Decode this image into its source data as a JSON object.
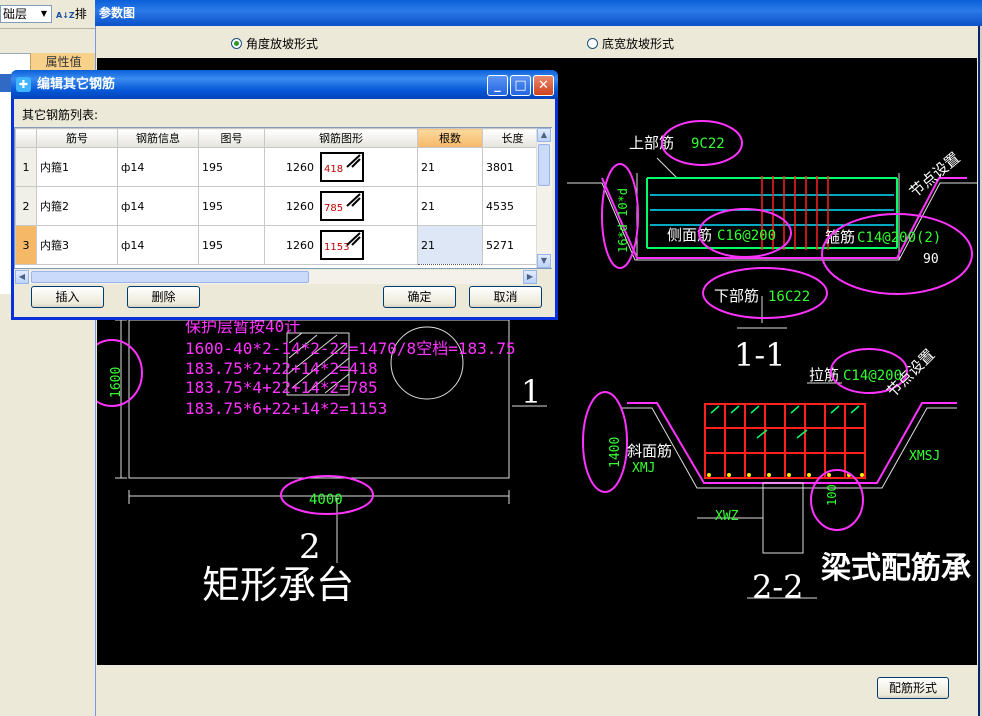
{
  "background_app": {
    "layer_select": "础层",
    "sort_label": "排",
    "attr_header": "属性值"
  },
  "param_window": {
    "title": "参数图",
    "radio_angle": "角度放坡形式",
    "radio_base": "底宽放坡形式",
    "radio_selected": "angle",
    "rebar_form_button": "配筋形式"
  },
  "drawing": {
    "top_bar_label": "上部筋",
    "top_bar_value": "9C22",
    "side_bar_label": "侧面筋",
    "side_bar_value": "C16@200",
    "stirrup_label": "箍筋",
    "stirrup_value": "C14@200(2)",
    "bottom_bar_label": "下部筋",
    "bottom_bar_value": "16C22",
    "anchor_label": "16*d 10*d",
    "angle_value": "90",
    "node_setting_1": "节点设置",
    "section_1": "1-1",
    "tie_label": "拉筋",
    "tie_value": "C14@200",
    "node_setting_2": "节点设置",
    "slope_bar_label": "斜面筋",
    "xmj": "XMJ",
    "xmsj": "XMSJ",
    "xwz": "XWZ",
    "height_1400": "1400",
    "dim_100": "100",
    "section_2": "2-2",
    "beam_title": "梁式配筋承",
    "calc_lines": [
      "保护层暂按40计",
      "1600-40*2-14*2-22=1470/8空档=183.75",
      "183.75*2+22+14*2=418",
      "183.75*4+22+14*2=785",
      "183.75*6+22+14*2=1153"
    ],
    "height_1600": "1600",
    "width_4000": "4000",
    "view_1": "1",
    "view_2": "2",
    "rect_title": "矩形承台"
  },
  "dialog": {
    "title": "编辑其它钢筋",
    "list_label": "其它钢筋列表:",
    "columns": [
      "筋号",
      "钢筋信息",
      "图号",
      "钢筋图形",
      "根数",
      "长度"
    ],
    "rows": [
      {
        "no": "1",
        "name": "内箍1",
        "info": "ф14",
        "fig": "195",
        "shape_value": "1260",
        "shape_num": "418",
        "count": "21",
        "length": "3801"
      },
      {
        "no": "2",
        "name": "内箍2",
        "info": "ф14",
        "fig": "195",
        "shape_value": "1260",
        "shape_num": "785",
        "count": "21",
        "length": "4535"
      },
      {
        "no": "3",
        "name": "内箍3",
        "info": "ф14",
        "fig": "195",
        "shape_value": "1260",
        "shape_num": "1153",
        "count": "21",
        "length": "5271"
      }
    ],
    "selected_row": "3",
    "buttons": {
      "insert": "插入",
      "delete": "删除",
      "ok": "确定",
      "cancel": "取消"
    }
  },
  "colors": {
    "annotation": "#ff33ff",
    "dim_green": "#33ff33",
    "rebar_red": "#ff2020",
    "rebar_green": "#00ff66",
    "rebar_cyan": "#00e0ff"
  }
}
